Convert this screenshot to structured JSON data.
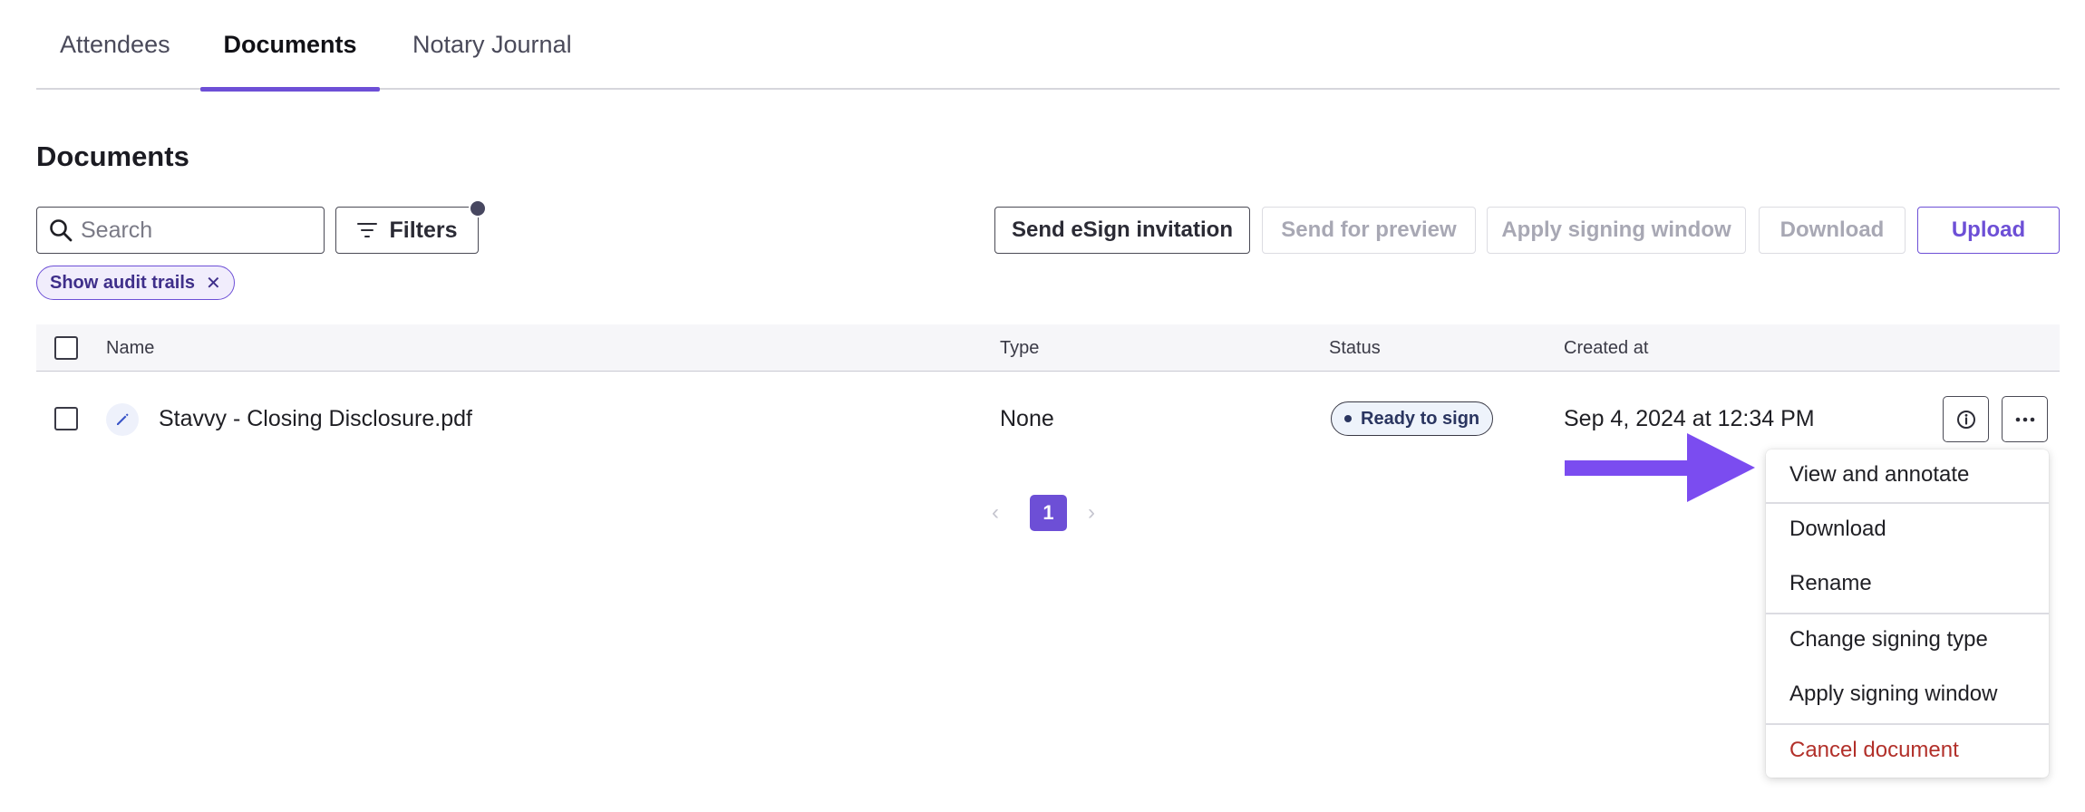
{
  "tabs": [
    {
      "label": "Attendees"
    },
    {
      "label": "Documents"
    },
    {
      "label": "Notary Journal"
    }
  ],
  "section": {
    "title": "Documents"
  },
  "search": {
    "placeholder": "Search",
    "value": ""
  },
  "filters": {
    "label": "Filters"
  },
  "actions": {
    "send_esign": "Send eSign invitation",
    "send_preview": "Send for preview",
    "apply_window": "Apply signing window",
    "download": "Download",
    "upload": "Upload"
  },
  "chip": {
    "label": "Show audit trails",
    "close": "✕"
  },
  "table": {
    "headers": {
      "name": "Name",
      "type": "Type",
      "status": "Status",
      "created": "Created at"
    },
    "rows": [
      {
        "name": "Stavvy - Closing Disclosure.pdf",
        "type": "None",
        "status": "Ready to sign",
        "created": "Sep 4, 2024 at 12:34 PM"
      }
    ]
  },
  "pagination": {
    "current": "1",
    "prev": "‹",
    "next": "›"
  },
  "menu": {
    "items": [
      {
        "label": "View and annotate"
      },
      {
        "label": "Download"
      },
      {
        "label": "Rename"
      },
      {
        "label": "Change signing type"
      },
      {
        "label": "Apply signing window"
      },
      {
        "label": "Cancel document"
      }
    ]
  },
  "colors": {
    "accent": "#6d4fd6",
    "danger": "#b2302a",
    "annotation_arrow": "#7b4cf0"
  }
}
